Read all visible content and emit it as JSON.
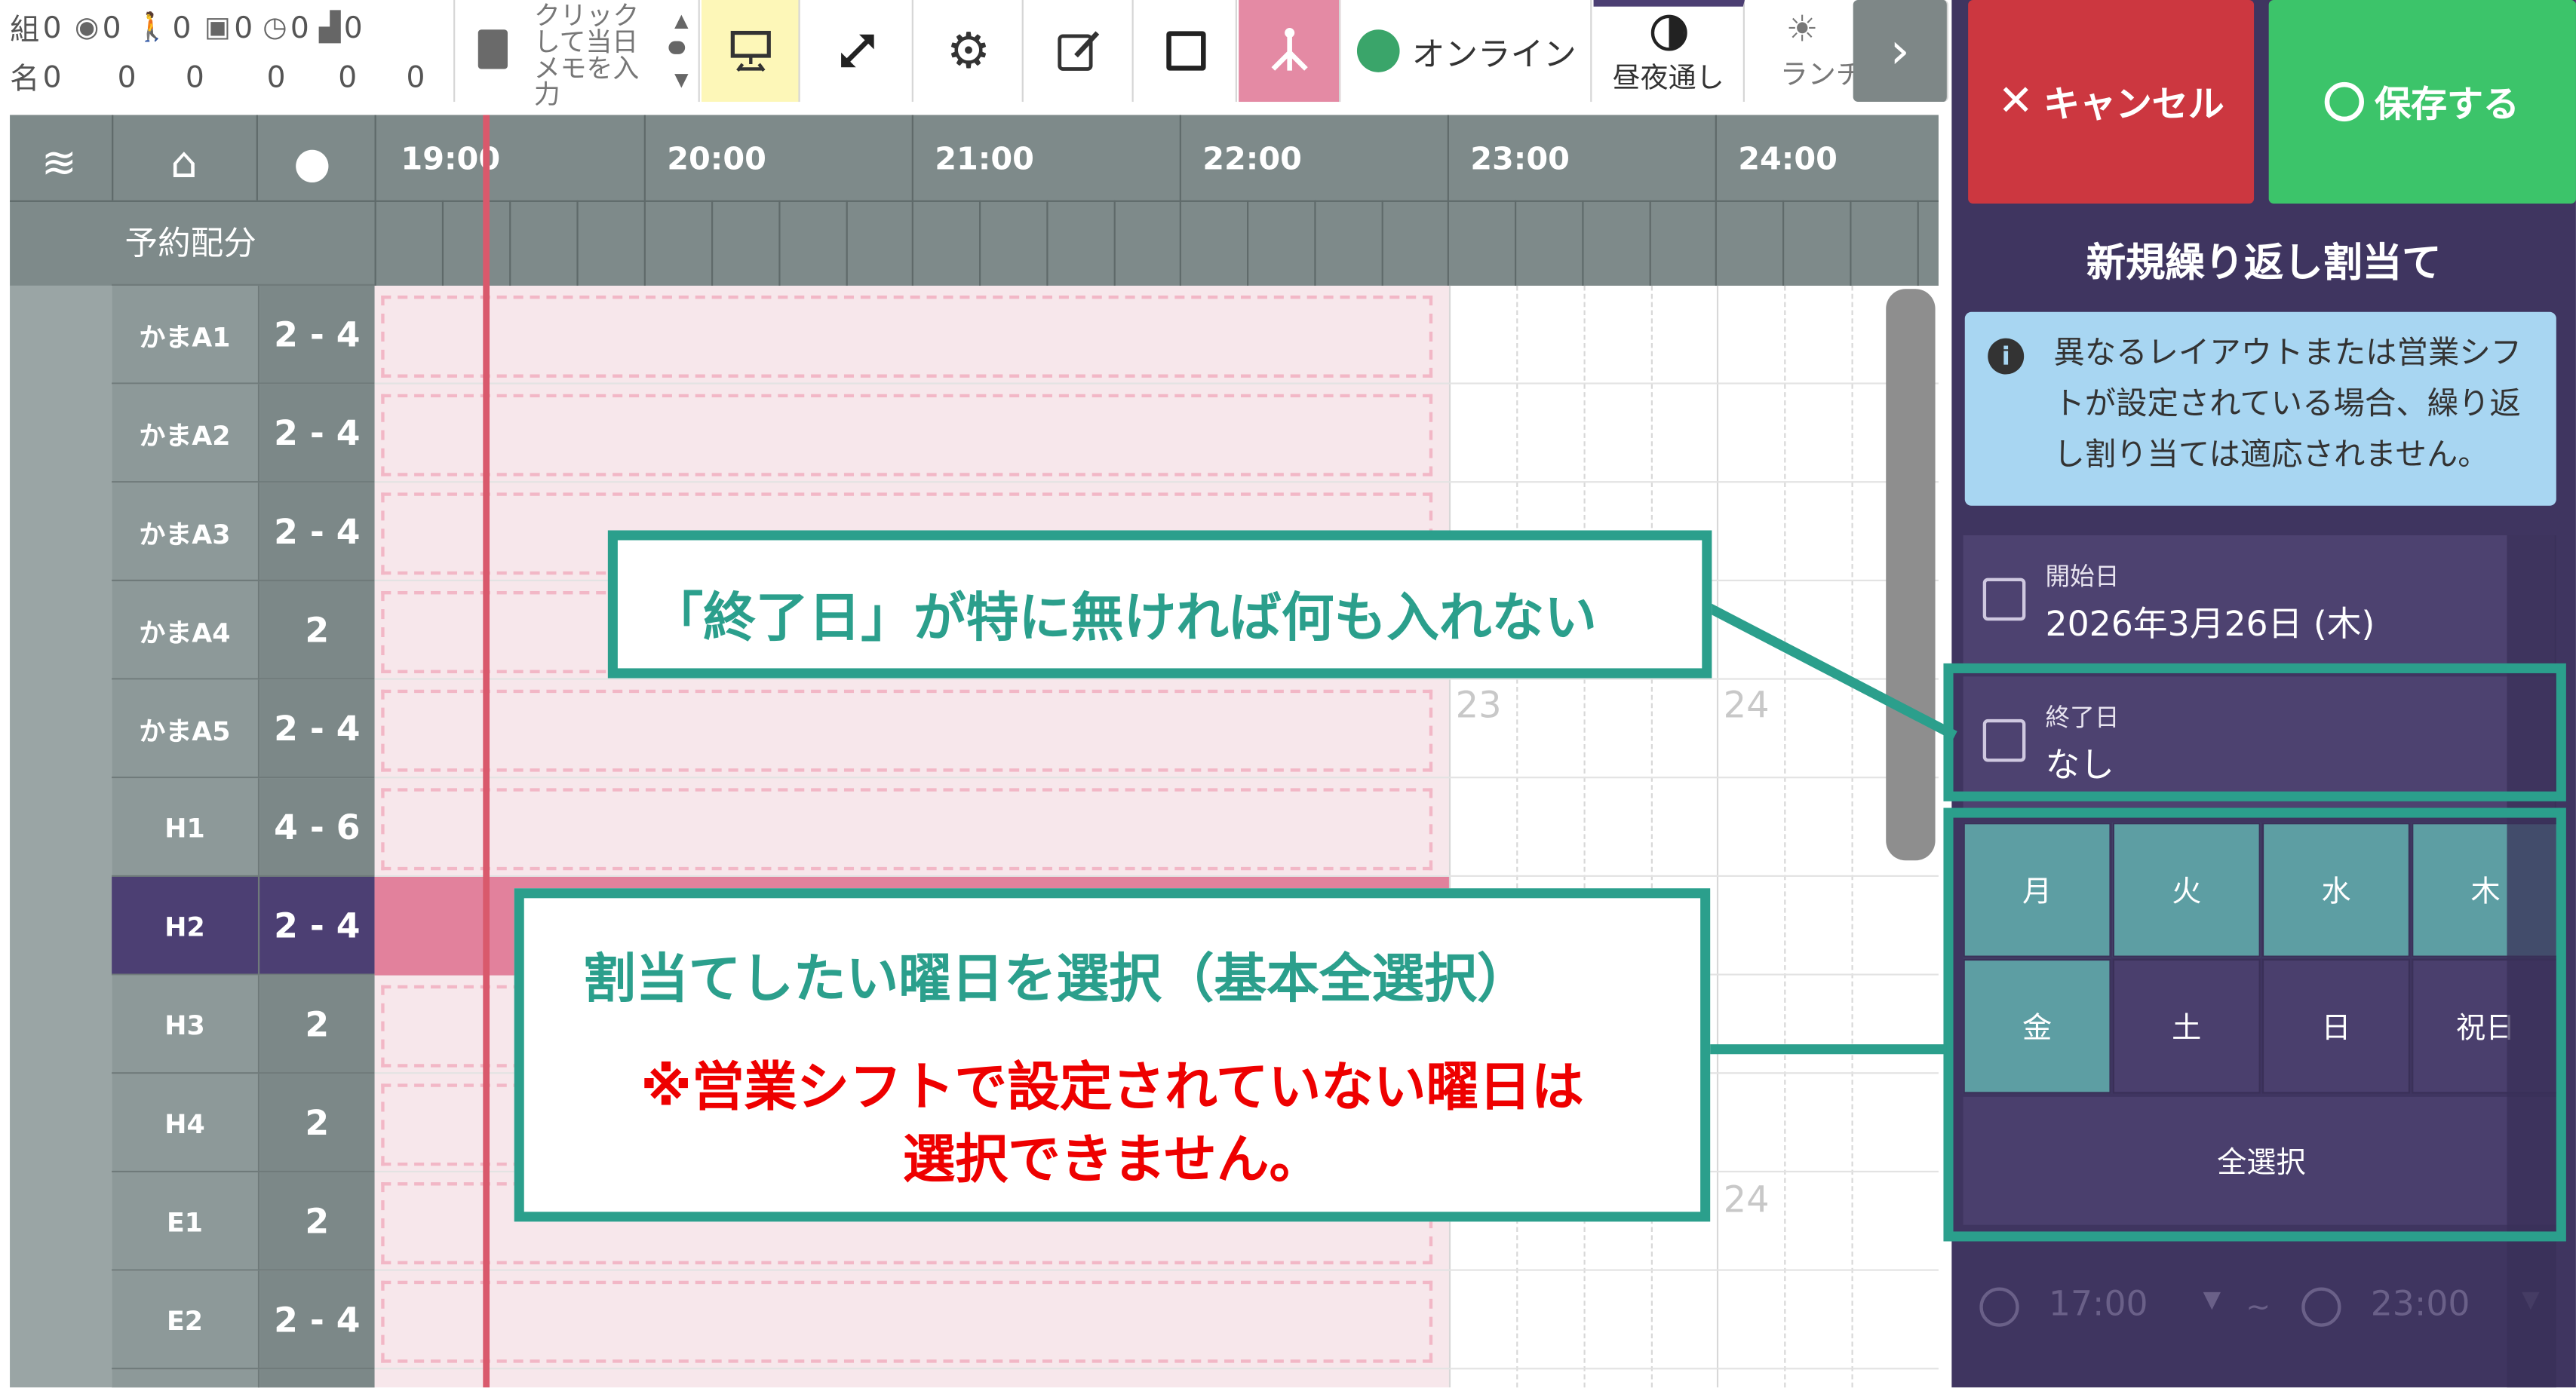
{
  "toolbar": {
    "stats_top": [
      "組",
      "0",
      "0",
      "0",
      "0",
      "0",
      "0"
    ],
    "stats_bottom": [
      "名",
      "0",
      "0",
      "0",
      "0",
      "0",
      "0"
    ],
    "memo_text": "クリックして当日メモを入力",
    "online_label": "オンライン",
    "daynight_label": "昼夜通し",
    "lunch_label": "ランチ"
  },
  "grid": {
    "allocation_label": "予約配分",
    "times": [
      "19:00",
      "20:00",
      "21:00",
      "22:00",
      "23:00",
      "24:00"
    ],
    "hour_marks": [
      "23",
      "24",
      "24"
    ],
    "rows": [
      {
        "name": "かまA1",
        "cap": "2 - 4"
      },
      {
        "name": "かまA2",
        "cap": "2 - 4"
      },
      {
        "name": "かまA3",
        "cap": "2 - 4"
      },
      {
        "name": "かまA4",
        "cap": "2"
      },
      {
        "name": "かまA5",
        "cap": "2 - 4"
      },
      {
        "name": "H1",
        "cap": "4 - 6"
      },
      {
        "name": "H2",
        "cap": "2 - 4"
      },
      {
        "name": "H3",
        "cap": "2"
      },
      {
        "name": "H4",
        "cap": "2"
      },
      {
        "name": "E1",
        "cap": "2"
      },
      {
        "name": "E2",
        "cap": "2 - 4"
      }
    ]
  },
  "panel": {
    "cancel_label": "キャンセル",
    "save_label": "保存する",
    "title": "新規繰り返し割当て",
    "info_text": "異なるレイアウトまたは営業シフトが設定されている場合、繰り返し割り当ては適応されません。",
    "start_label": "開始日",
    "start_value": "2026年3月26日 (木)",
    "end_label": "終了日",
    "end_value": "なし",
    "days": [
      "月",
      "火",
      "水",
      "木",
      "金",
      "土",
      "日",
      "祝日"
    ],
    "select_all_label": "全選択",
    "time_from": "17:00",
    "time_to": "23:00",
    "time_sep": "~"
  },
  "callouts": {
    "end_date_note": "「終了日」が特に無ければ何も入れない",
    "weekday_note": "割当てしたい曜日を選択（基本全選択）",
    "warning_line1": "※営業シフトで設定されていない曜日は",
    "warning_line2": "選択できません。"
  },
  "colors": {
    "accent_teal": "#2b9f8c",
    "cancel_red": "#cc3740",
    "save_green": "#3cc46a",
    "panel_purple": "#3f3560",
    "warning_red": "#ee0000"
  }
}
